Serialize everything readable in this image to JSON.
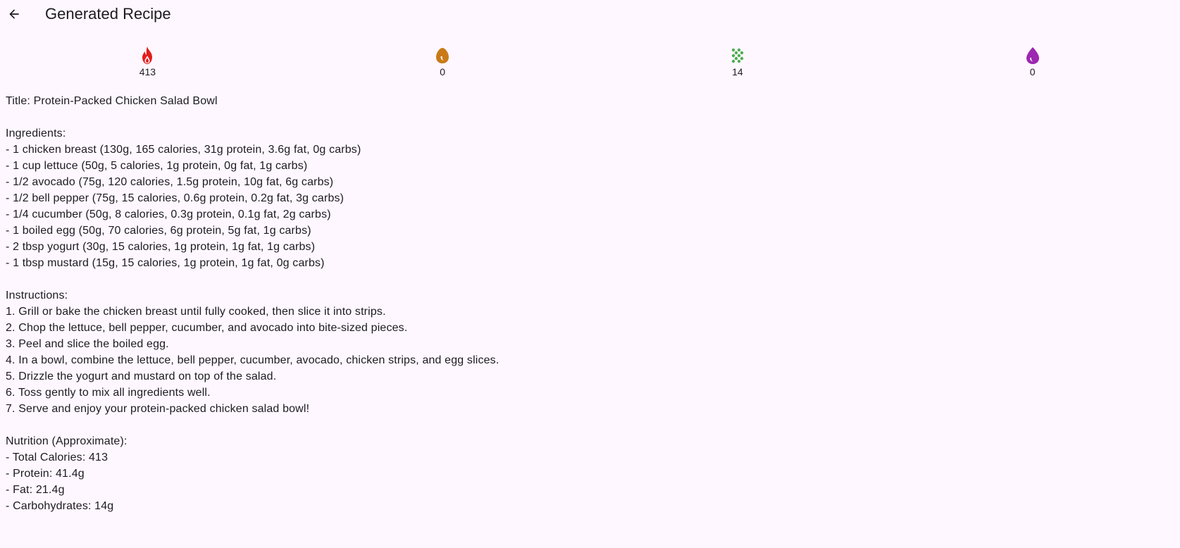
{
  "header": {
    "title": "Generated Recipe",
    "back_icon": "arrow-back-icon"
  },
  "macros": [
    {
      "icon": "fire-icon",
      "color": "#e31c1c",
      "value": "413"
    },
    {
      "icon": "egg-icon",
      "color": "#c97a16",
      "value": "0"
    },
    {
      "icon": "grain-icon",
      "color": "#4caf50",
      "value": "14"
    },
    {
      "icon": "water-drop-icon",
      "color": "#9c27b0",
      "value": "0"
    }
  ],
  "recipe": {
    "title": "Title: Protein-Packed Chicken Salad Bowl",
    "ingredients_heading": "Ingredients:",
    "ingredients": [
      "- 1 chicken breast (130g, 165 calories, 31g protein, 3.6g fat, 0g carbs)",
      "- 1 cup lettuce (50g, 5 calories, 1g protein, 0g fat, 1g carbs)",
      "- 1/2 avocado (75g, 120 calories, 1.5g protein, 10g fat, 6g carbs)",
      "- 1/2 bell pepper (75g, 15 calories, 0.6g protein, 0.2g fat, 3g carbs)",
      "- 1/4 cucumber (50g, 8 calories, 0.3g protein, 0.1g fat, 2g carbs)",
      "- 1 boiled egg (50g, 70 calories, 6g protein, 5g fat, 1g carbs)",
      "- 2 tbsp yogurt (30g, 15 calories, 1g protein, 1g fat, 1g carbs)",
      "- 1 tbsp mustard (15g, 15 calories, 1g protein, 1g fat, 0g carbs)"
    ],
    "instructions_heading": "Instructions:",
    "instructions": [
      "1. Grill or bake the chicken breast until fully cooked, then slice it into strips.",
      "2. Chop the lettuce, bell pepper, cucumber, and avocado into bite-sized pieces.",
      "3. Peel and slice the boiled egg.",
      "4. In a bowl, combine the lettuce, bell pepper, cucumber, avocado, chicken strips, and egg slices.",
      "5. Drizzle the yogurt and mustard on top of the salad.",
      "6. Toss gently to mix all ingredients well.",
      "7. Serve and enjoy your protein-packed chicken salad bowl!"
    ],
    "nutrition_heading": "Nutrition (Approximate):",
    "nutrition": [
      "- Total Calories: 413",
      "- Protein: 41.4g",
      "- Fat: 21.4g",
      "- Carbohydrates: 14g"
    ]
  }
}
